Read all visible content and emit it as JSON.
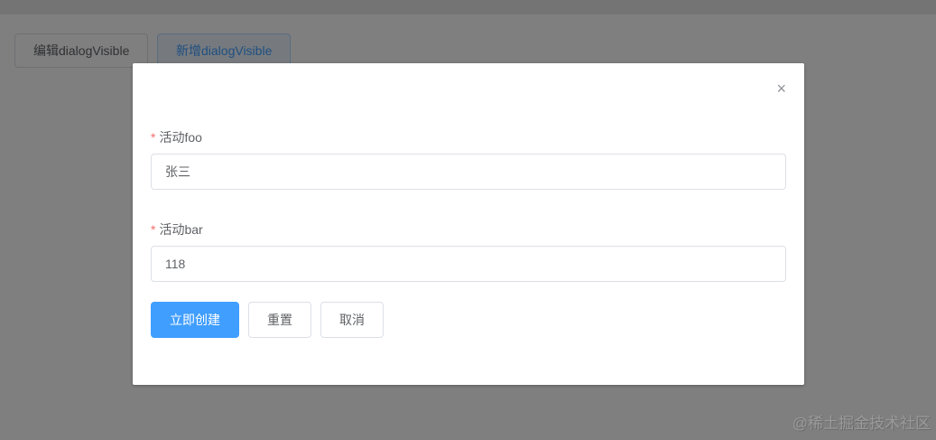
{
  "page": {
    "edit_button": "编辑dialogVisible",
    "add_button": "新增dialogVisible"
  },
  "dialog": {
    "close_icon": "×",
    "fields": [
      {
        "required_mark": "*",
        "label": "活动foo",
        "value": "张三"
      },
      {
        "required_mark": "*",
        "label": "活动bar",
        "value": "118"
      }
    ],
    "buttons": {
      "create": "立即创建",
      "reset": "重置",
      "cancel": "取消"
    }
  },
  "watermark": "@稀土掘金技术社区",
  "colors": {
    "primary": "#409eff",
    "required": "#f56c6c"
  }
}
